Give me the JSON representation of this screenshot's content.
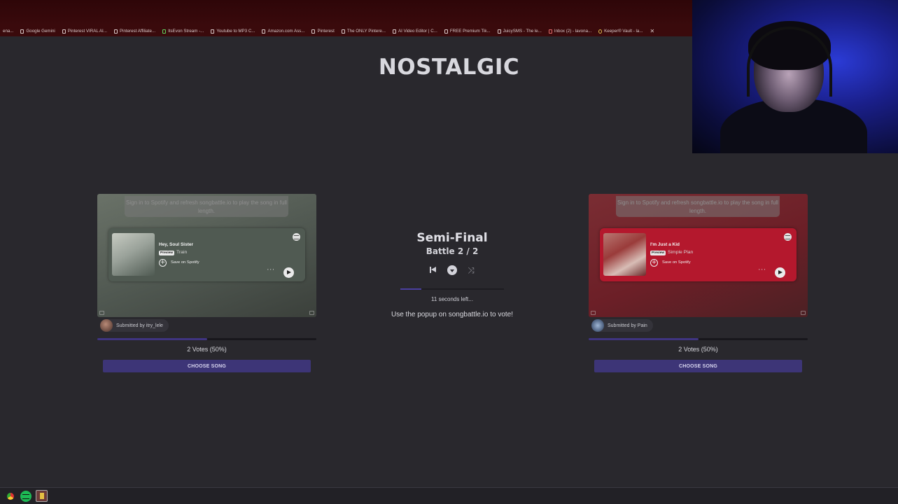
{
  "browser": {
    "bookmarks": [
      "ena...",
      "Google Gemini",
      "Pinterest VIRAL AI...",
      "Pinterest Affiliate...",
      "ItsEvon Stream -...",
      "Youtube to MP3 C...",
      "Amazon.com Ass...",
      "Pinterest",
      "The ONLY Pintere...",
      "AI Video Editor | C...",
      "FREE Premium Tik...",
      "JuicySMS - The le...",
      "Inbox (2) - lavona...",
      "Keeper® Vault - la..."
    ]
  },
  "page": {
    "title": "NOSTALGIC"
  },
  "battle": {
    "stage": "Semi-Final",
    "round": "Battle 2 / 2",
    "timer": "11 seconds left...",
    "timer_progress": 0.2,
    "popup_message": "Use the popup on songbattle.io to vote!"
  },
  "songs": [
    {
      "hint": "Sign in to Spotify and refresh songbattle.io to play the song in full length.",
      "title": "Hey, Soul Sister",
      "preview_badge": "Preview",
      "artist": "Train",
      "save_label": "Save on Spotify",
      "submitted_by": "Submitted by itry_lele",
      "vote_share": 0.5,
      "votes_label": "2 Votes (50%)",
      "choose_label": "CHOOSE SONG"
    },
    {
      "hint": "Sign in to Spotify and refresh songbattle.io to play the song in full length.",
      "title": "I'm Just a Kid",
      "preview_badge": "Preview",
      "artist": "Simple Plan",
      "save_label": "Save on Spotify",
      "submitted_by": "Submitted by Pain",
      "vote_share": 0.5,
      "votes_label": "2 Votes (50%)",
      "choose_label": "CHOOSE SONG"
    }
  ],
  "colors": {
    "background": "#29282d",
    "accent": "#3d3577",
    "card_left": "#505a52",
    "card_right": "#b4182d"
  },
  "taskbar": {
    "icons": [
      "chrome-icon",
      "spotify-icon",
      "app-icon"
    ]
  }
}
